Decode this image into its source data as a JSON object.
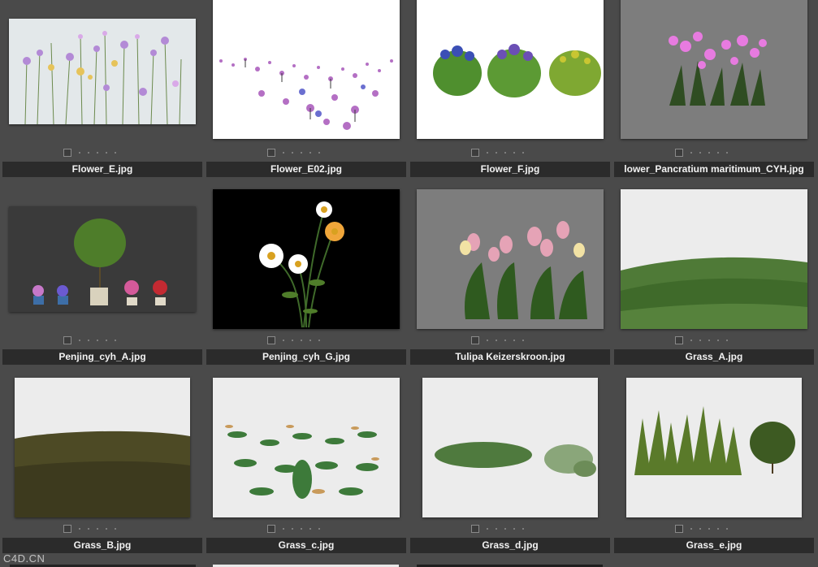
{
  "files": [
    {
      "name": "Flower_E.jpg",
      "thumb": "flower-field-thumbnail"
    },
    {
      "name": "Flower_E02.jpg",
      "thumb": "flower-meadow-thumbnail"
    },
    {
      "name": "Flower_F.jpg",
      "thumb": "flower-bushes-thumbnail"
    },
    {
      "name": "lower_Pancratium maritimum_CYH.jpg",
      "thumb": "pink-lily-thumbnail"
    },
    {
      "name": "Penjing_cyh_A.jpg",
      "thumb": "potted-plants-thumbnail"
    },
    {
      "name": "Penjing_cyh_G.jpg",
      "thumb": "daisy-thumbnail"
    },
    {
      "name": "Tulipa Keizerskroon.jpg",
      "thumb": "tulip-thumbnail"
    },
    {
      "name": "Grass_A.jpg",
      "thumb": "grass-hill-thumbnail"
    },
    {
      "name": "Grass_B.jpg",
      "thumb": "tall-grass-thumbnail"
    },
    {
      "name": "Grass_c.jpg",
      "thumb": "ground-plants-thumbnail"
    },
    {
      "name": "Grass_d.jpg",
      "thumb": "grass-tufts-thumbnail"
    },
    {
      "name": "Grass_e.jpg",
      "thumb": "grass-shrub-thumbnail"
    }
  ],
  "watermark": "C4D.CN",
  "colors": {
    "background": "#4a4a4a",
    "label_bar": "#2b2b2b",
    "label_text": "#f2f2f2"
  }
}
